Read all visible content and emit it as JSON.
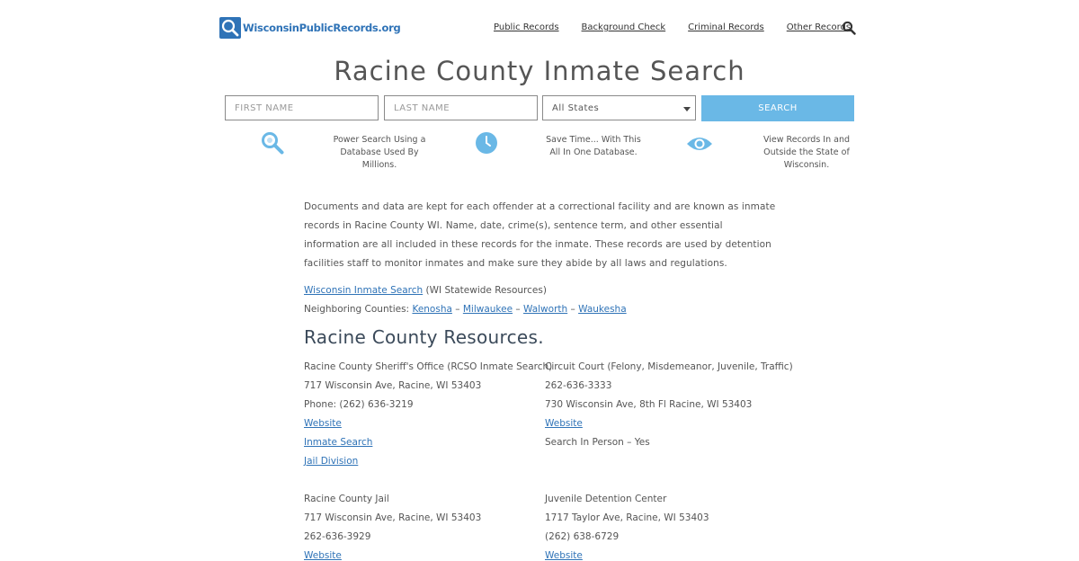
{
  "header": {
    "logo_text": "WisconsinPublicRecords.org",
    "nav": [
      "Public Records",
      "Background Check",
      "Criminal Records",
      "Other Records"
    ]
  },
  "title": "Racine County Inmate Search",
  "form": {
    "first_name_placeholder": "FIRST NAME",
    "last_name_placeholder": "LAST NAME",
    "state_selected": "All States",
    "search_label": "SEARCH"
  },
  "features": [
    {
      "icon": "magnifier-icon",
      "text": [
        "Power Search Using a",
        "Database Used By",
        "Millions."
      ]
    },
    {
      "icon": "clock-icon",
      "text": [
        "Save Time... With This",
        "All In One Database."
      ]
    },
    {
      "icon": "eye-icon",
      "text": [
        "View Records In and",
        "Outside the State of",
        "Wisconsin."
      ]
    }
  ],
  "intro": "Documents and data are kept for each offender at a correctional facility and are known as inmate records in Racine County WI. Name, date, crime(s), sentence term, and other essential information are all included in these records for the inmate. These records are used by detention facilities staff to monitor inmates and make sure they abide by all laws and regulations.",
  "statewide": {
    "link": "Wisconsin Inmate Search",
    "suffix": "(WI Statewide Resources)"
  },
  "neighboring": {
    "label": "Neighboring Counties:",
    "counties": [
      "Kenosha",
      "Milwaukee",
      "Walworth",
      "Waukesha"
    ],
    "sep": "–"
  },
  "resources_heading": "Racine County Resources.",
  "resources": {
    "sheriff": {
      "name": "Racine County Sheriff's Office (RCSO Inmate Search)",
      "address": "717 Wisconsin Ave, Racine, WI 53403",
      "phone": "Phone: (262) 636-3219",
      "links": [
        "Website",
        "Inmate Search",
        "Jail Division"
      ]
    },
    "court": {
      "name": "Circuit Court (Felony, Misdemeanor, Juvenile, Traffic)",
      "phone": "262-636-3333",
      "address": "730 Wisconsin Ave, 8th Fl Racine, WI 53403",
      "link": "Website",
      "note": "Search In Person – Yes"
    },
    "jail": {
      "name": "Racine County Jail",
      "address": "717 Wisconsin Ave, Racine, WI 53403",
      "phone": "262-636-3929",
      "link": "Website"
    },
    "juvenile": {
      "name": "Juvenile Detention Center",
      "address": "1717 Taylor Ave, Racine, WI 53403",
      "phone": "(262) 638-6729",
      "link": "Website"
    }
  },
  "colors": {
    "link": "#2f73b7",
    "button": "#6ab8e6",
    "icon": "#6ab8e6",
    "logo": "#2f73b7"
  }
}
